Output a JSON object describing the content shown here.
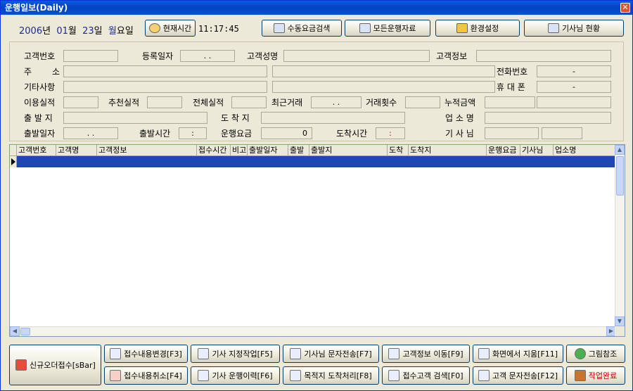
{
  "window": {
    "title": "운행일보(Daily)",
    "close": "✕"
  },
  "date": {
    "year": "2006",
    "year_unit": "년",
    "month": "01",
    "month_unit": "월",
    "day": "23",
    "day_unit": "일",
    "weekday": "월",
    "weekday_unit": "요일"
  },
  "toolbar": {
    "now_label": "현재시간",
    "time": "11:17:45",
    "manual_fee_search": "수동요금검색",
    "all_data": "모든운행자료",
    "settings": "환경설정",
    "driver_status": "기사님 현황"
  },
  "form": {
    "customer_no": "고객번호",
    "reg_date": "등록일자",
    "reg_date_value": ".   .",
    "customer_name": "고객성명",
    "customer_info": "고객정보",
    "address_a": "주",
    "address_b": "소",
    "phone": "전화번호",
    "phone_value": "-",
    "etc": "기타사항",
    "mobile": "휴 대 폰",
    "mobile_value": "-",
    "usage": "이용실적",
    "referral": "추천실적",
    "total": "전체실적",
    "last_trade": "최근거래",
    "last_trade_value": ".   .",
    "trade_count": "거래횟수",
    "accum_amount": "누적금액",
    "origin": "출 발 지",
    "destination": "도 착 지",
    "business_name": "업 소 명",
    "depart_date": "출발일자",
    "depart_date_value": ".   .",
    "depart_time": "출발시간",
    "depart_time_value": ":",
    "fare": "운행요금",
    "fare_value": "0",
    "arrive_time": "도착시간",
    "arrive_time_value": ":",
    "driver": "기 사 님"
  },
  "grid": {
    "columns": [
      "고객번호",
      "고객명",
      "고객정보",
      "접수시간",
      "비고",
      "출발일자",
      "출발",
      "출발지",
      "도착",
      "도착지",
      "운행요금",
      "기사님",
      "업소명"
    ]
  },
  "actions": {
    "new_order": "신규오더접수[sBar]",
    "edit_order": "접수내용변경[F3]",
    "cancel_order": "접수내용취소[F4]",
    "assign_driver": "기사 지정작업[F5]",
    "driver_history": "기사 운행이력[F6]",
    "driver_sms": "기사님 문자전송[F7]",
    "dest_arrival": "목적지 도착처리[F8]",
    "move_customer": "고객정보 이동[F9]",
    "search_customer": "접수고객 검색[F0]",
    "clear_screen": "화면에서 지움[F11]",
    "customer_sms": "고객 문자전송[F12]",
    "picture_ref": "그림참조",
    "complete": "작업완료"
  },
  "colors": {
    "accent": "#1f47b4",
    "title_bar": "#0342c2",
    "complete_text": "#c00000"
  }
}
